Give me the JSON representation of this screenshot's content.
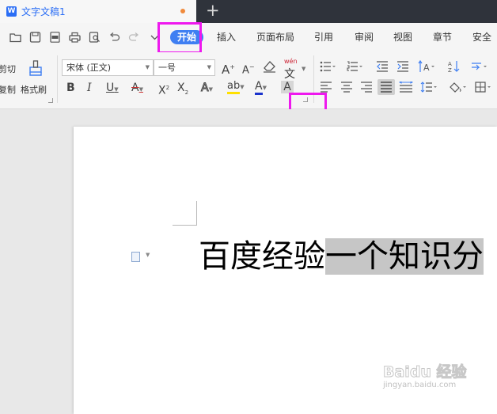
{
  "tab": {
    "title": "文字文稿1",
    "logo": "W",
    "new_tab": "+"
  },
  "menu": {
    "active": "开始",
    "items": [
      "插入",
      "页面布局",
      "引用",
      "审阅",
      "视图",
      "章节",
      "安全"
    ]
  },
  "quick_access_icons": [
    "open-folder-icon",
    "save-icon",
    "export-pdf-icon",
    "print-icon",
    "print-preview-icon",
    "undo-icon",
    "redo-icon",
    "more-dropdown-icon"
  ],
  "clipboard": {
    "cut": "剪切",
    "copy": "复制",
    "format_painter": "格式刷"
  },
  "font": {
    "name": "宋体 (正文)",
    "size": "一号",
    "pinyin": "wén",
    "pinyin_char": "文",
    "text_a": "A",
    "highlight_ab": "ab"
  },
  "document": {
    "text_normal": "百度经验",
    "text_selected": "一个知识分"
  },
  "watermark": {
    "main": "Baidu 经验",
    "sub": "jingyan.baidu.com"
  },
  "colors": {
    "accent": "#3f7ff2",
    "highlight_box": "#ee18ee",
    "font_color": "#1a33cc",
    "highlight_yellow": "#ffe000",
    "selection": "#c6c6c6"
  }
}
